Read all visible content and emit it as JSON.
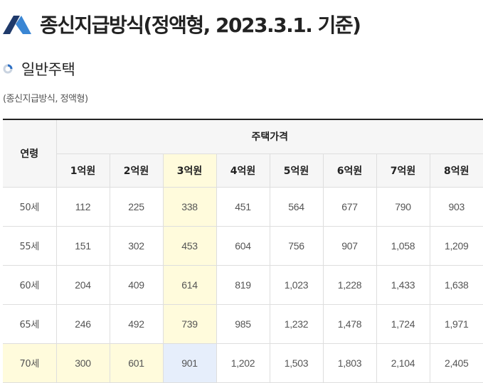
{
  "header": {
    "title": "종신지급방식(정액형, 2023.3.1. 기준)",
    "logo_icon": "triangle-logo-icon"
  },
  "section": {
    "title": "일반주택",
    "icon": "ring-bullet-icon"
  },
  "note": "(종신지급방식, 정액형)",
  "colors": {
    "logo_dark": "#1f3a6b",
    "logo_light": "#3a86d4",
    "highlight_column": "#fffbdc",
    "highlight_cell": "#e6eefb",
    "header_bg": "#f6f6f6"
  },
  "table": {
    "age_header": "연령",
    "price_header": "주택가격",
    "columns": [
      "1억원",
      "2억원",
      "3억원",
      "4억원",
      "5억원",
      "6억원",
      "7억원",
      "8억원"
    ],
    "rows": [
      {
        "age": "50세",
        "values": [
          "112",
          "225",
          "338",
          "451",
          "564",
          "677",
          "790",
          "903"
        ]
      },
      {
        "age": "55세",
        "values": [
          "151",
          "302",
          "453",
          "604",
          "756",
          "907",
          "1,058",
          "1,209"
        ]
      },
      {
        "age": "60세",
        "values": [
          "204",
          "409",
          "614",
          "819",
          "1,023",
          "1,228",
          "1,433",
          "1,638"
        ]
      },
      {
        "age": "65세",
        "values": [
          "246",
          "492",
          "739",
          "985",
          "1,232",
          "1,478",
          "1,724",
          "1,971"
        ]
      },
      {
        "age": "70세",
        "values": [
          "300",
          "601",
          "901",
          "1,202",
          "1,503",
          "1,803",
          "2,104",
          "2,405"
        ]
      }
    ]
  }
}
